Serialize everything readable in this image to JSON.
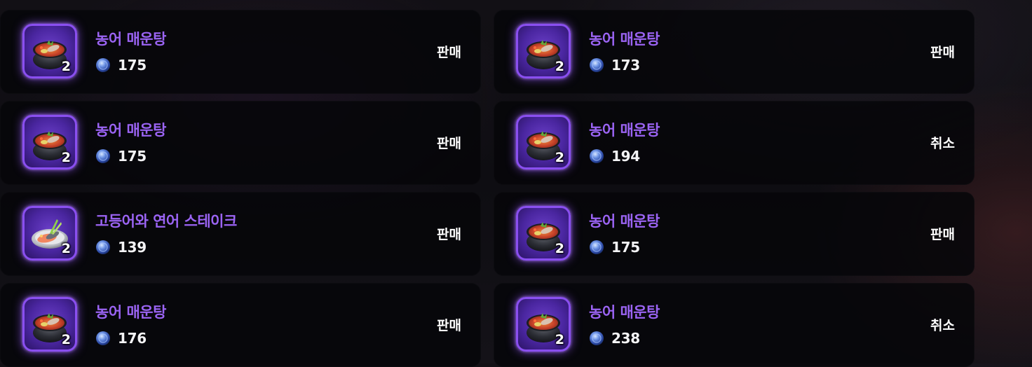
{
  "listings": [
    {
      "name": "농어 매운탕",
      "price": "175",
      "qty": "2",
      "action": "판매",
      "icon": "spicy-fish-stew-icon"
    },
    {
      "name": "농어 매운탕",
      "price": "173",
      "qty": "2",
      "action": "판매",
      "icon": "spicy-fish-stew-icon"
    },
    {
      "name": "농어 매운탕",
      "price": "175",
      "qty": "2",
      "action": "판매",
      "icon": "spicy-fish-stew-icon"
    },
    {
      "name": "농어 매운탕",
      "price": "194",
      "qty": "2",
      "action": "취소",
      "icon": "spicy-fish-stew-icon"
    },
    {
      "name": "고등어와 연어 스테이크",
      "price": "139",
      "qty": "2",
      "action": "판매",
      "icon": "mackerel-salmon-steak-icon"
    },
    {
      "name": "농어 매운탕",
      "price": "175",
      "qty": "2",
      "action": "판매",
      "icon": "spicy-fish-stew-icon"
    },
    {
      "name": "농어 매운탕",
      "price": "176",
      "qty": "2",
      "action": "판매",
      "icon": "spicy-fish-stew-icon"
    },
    {
      "name": "농어 매운탕",
      "price": "238",
      "qty": "2",
      "action": "취소",
      "icon": "spicy-fish-stew-icon"
    }
  ],
  "colors": {
    "item_name": "#9b64f4",
    "slot_border": "#8a4ff0",
    "price_text": "#f4f4f6",
    "action_text": "#ffffff",
    "card_bg": "#060609"
  },
  "currency_icon": "blue-gem-coin-icon"
}
